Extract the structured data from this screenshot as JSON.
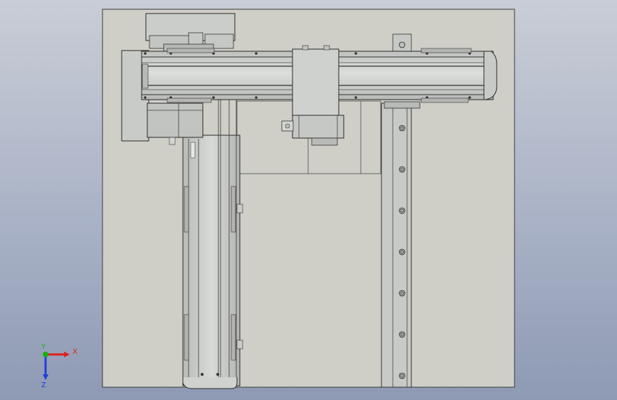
{
  "viewport": {
    "background_top": "#c9cdd6",
    "background_bottom": "#8e9ab4",
    "sheet_color": "#cfcfc8",
    "part_color": "#c4c6c3",
    "edge_color": "#2a2a2a"
  },
  "triad": {
    "x_label": "X",
    "y_label": "Y",
    "z_label": "Z",
    "x_color": "#e02020",
    "y_color": "#18b018",
    "z_color": "#2040d8"
  },
  "icons": [
    "coordinate-triad-icon"
  ]
}
